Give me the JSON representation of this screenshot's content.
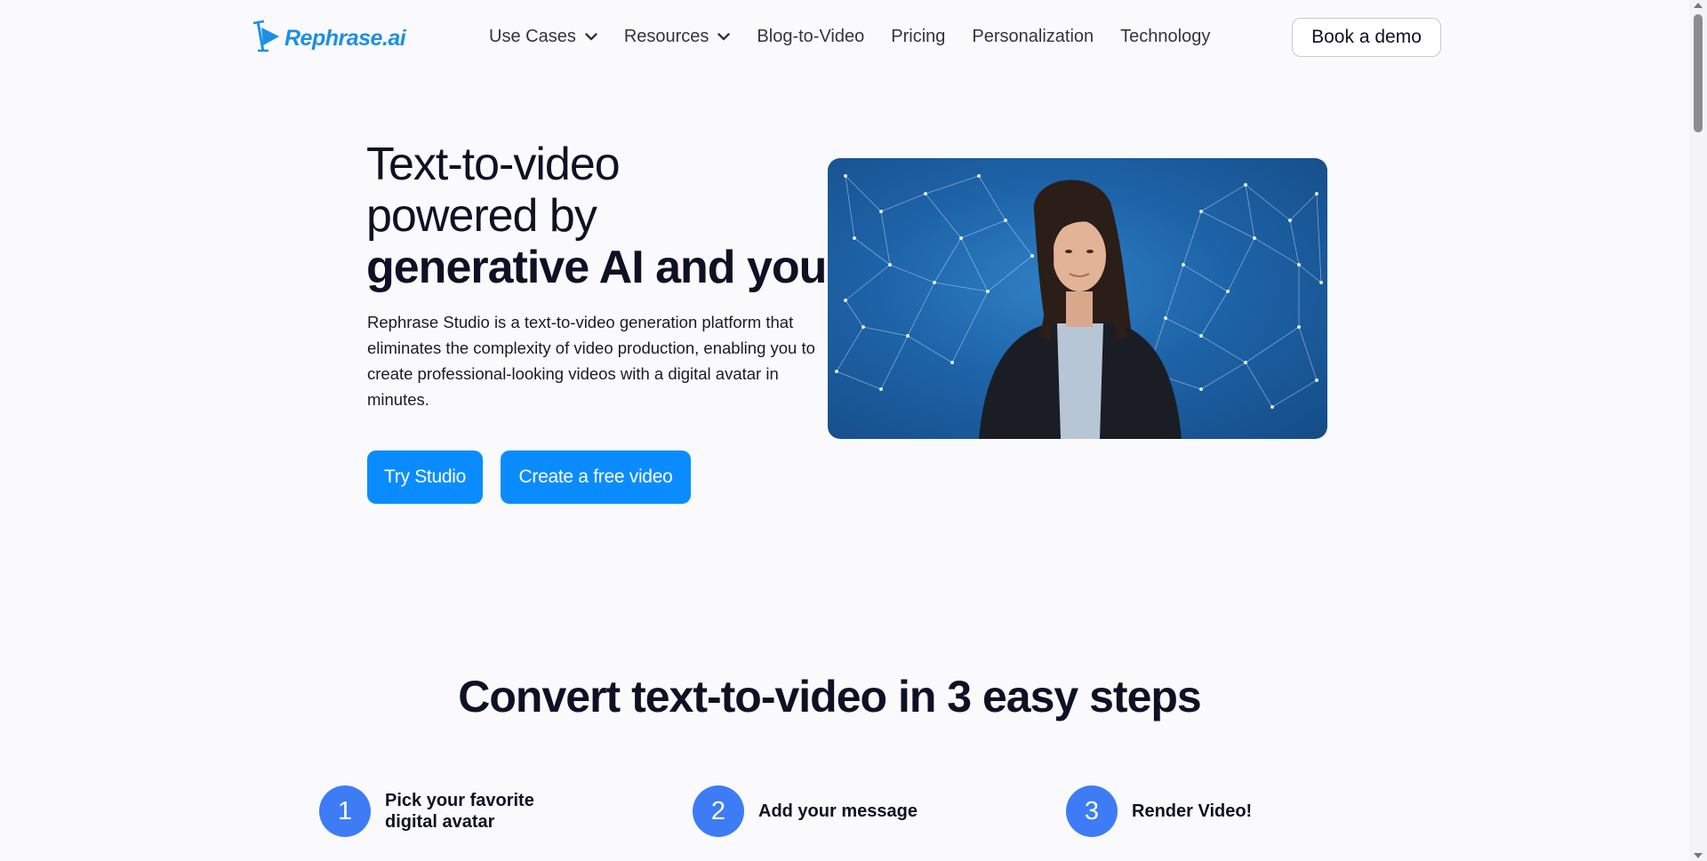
{
  "brand": {
    "name": "Rephrase.ai",
    "accent_color": "#1e8fe6",
    "logo_icon": "rephrase-logo-icon"
  },
  "nav": {
    "items": [
      {
        "label": "Use Cases",
        "has_dropdown": true
      },
      {
        "label": "Resources",
        "has_dropdown": true
      },
      {
        "label": "Blog-to-Video",
        "has_dropdown": false
      },
      {
        "label": "Pricing",
        "has_dropdown": false
      },
      {
        "label": "Personalization",
        "has_dropdown": false
      },
      {
        "label": "Technology",
        "has_dropdown": false
      }
    ],
    "chevron_icon": "chevron-down-icon",
    "book_demo_label": "Book a demo"
  },
  "hero": {
    "title_line1": "Text-to-video",
    "title_line2": "powered by",
    "title_line3": "generative AI and you",
    "description": "Rephrase Studio is a text-to-video generation platform that eliminates the complexity of video production, enabling you to create professional-looking videos with a digital avatar in minutes.",
    "primary_button": "Try Studio",
    "secondary_button": "Create a free video",
    "button_color": "#0a8cff",
    "image": "digital-avatar-woman-network-background"
  },
  "steps_section": {
    "title_prefix": "Convert ",
    "title_bold": "text-to-video",
    "title_suffix": " in 3 easy steps",
    "step_color": "#3d7cf5",
    "steps": [
      {
        "number": "1",
        "label": "Pick your favorite digital avatar"
      },
      {
        "number": "2",
        "label": "Add your message"
      },
      {
        "number": "3",
        "label": "Render Video!"
      }
    ]
  }
}
